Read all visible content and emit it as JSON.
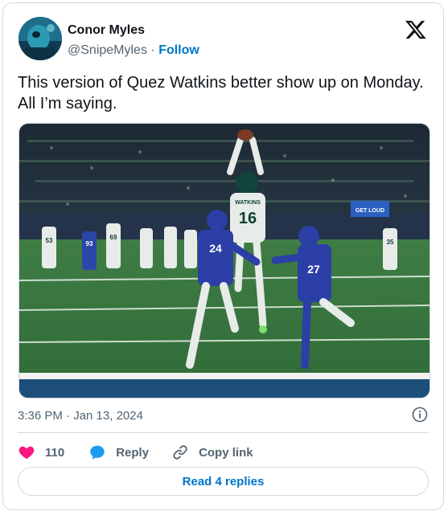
{
  "author": {
    "name": "Conor Myles",
    "handle": "@SnipeMyles",
    "separator": "·",
    "follow_label": "Follow"
  },
  "tweet": {
    "text": "This version of Quez Watkins better show up on Monday. All I’m saying.",
    "timestamp": "3:36 PM · Jan 13, 2024"
  },
  "media": {
    "jersey_number_receiver": "16",
    "receiver_name_on_jersey": "WATKINS",
    "defender_numbers": [
      "24",
      "27"
    ],
    "sideline_numbers": [
      "53",
      "69",
      "93",
      "35"
    ],
    "scoreboard_text": "GET LOUD"
  },
  "actions": {
    "like_count": "110",
    "reply_label": "Reply",
    "copy_link_label": "Copy link"
  },
  "read_replies_label": "Read 4 replies",
  "colors": {
    "link": "#0074c8",
    "heart": "#f91880",
    "reply_bubble": "#1d9bf0",
    "muted": "#536471",
    "border": "#cfd9de"
  },
  "icons": [
    "x-logo-icon",
    "info-icon",
    "heart-icon",
    "reply-icon",
    "copy-link-icon"
  ]
}
